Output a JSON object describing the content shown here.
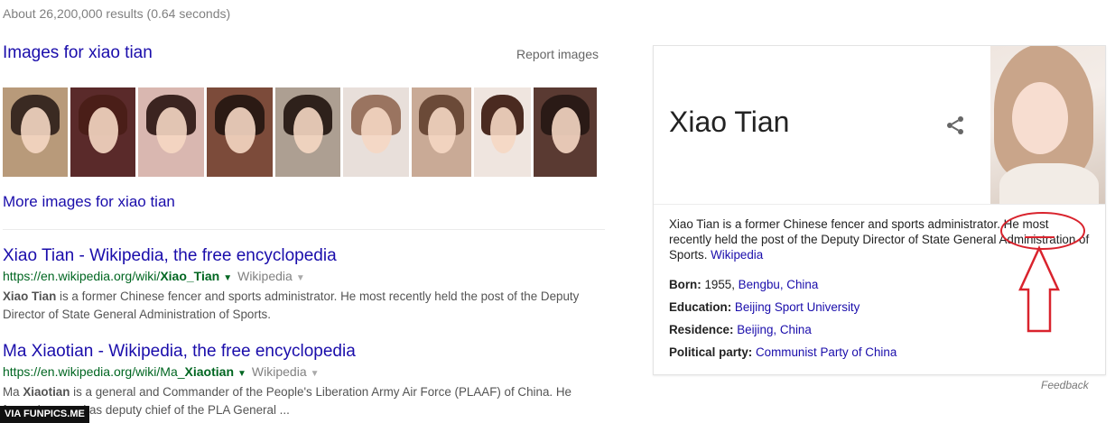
{
  "stats": "About 26,200,000 results (0.64 seconds)",
  "images_block": {
    "title": "Images for xiao tian",
    "report": "Report images",
    "more": "More images for xiao tian",
    "thumbs": [
      {
        "bg": "#b89a7a",
        "hair": "#3a2a22"
      },
      {
        "bg": "#5a2a2a",
        "hair": "#4a1e18"
      },
      {
        "bg": "#d9b7b0",
        "hair": "#3b2420"
      },
      {
        "bg": "#7c4b3a",
        "hair": "#2b1a14"
      },
      {
        "bg": "#ad9f92",
        "hair": "#2e211b"
      },
      {
        "bg": "#e8dfda",
        "hair": "#9a7460"
      },
      {
        "bg": "#c9aa96",
        "hair": "#6b4a38"
      },
      {
        "bg": "#efe5df",
        "hair": "#4a2a20"
      },
      {
        "bg": "#5a3a32",
        "hair": "#2a1a16"
      }
    ]
  },
  "results": [
    {
      "title": "Xiao Tian - Wikipedia, the free encyclopedia",
      "url_prefix": "https://en.wikipedia.org/wiki/",
      "url_bold": "Xiao_Tian",
      "source": "Wikipedia",
      "snippet_bold": "Xiao Tian",
      "snippet": " is a former Chinese fencer and sports administrator. He most recently held the post of the Deputy Director of State General Administration of Sports."
    },
    {
      "title": "Ma Xiaotian - Wikipedia, the free encyclopedia",
      "url_prefix": "https://en.wikipedia.org/wiki/Ma_",
      "url_bold": "Xiaotian",
      "source": "Wikipedia",
      "snippet_pre": "Ma ",
      "snippet_bold": "Xiaotian",
      "snippet": " is a general and Commander of the People's Liberation Army Air Force (PLAAF) of China. He formerly served as deputy chief of the PLA General ..."
    }
  ],
  "knowledge_panel": {
    "title": "Xiao Tian",
    "description": "Xiao Tian is a former Chinese fencer and sports administrator. He most recently held the post of the Deputy Director of State General Administration of Sports.",
    "source_link": "Wikipedia",
    "facts": [
      {
        "label": "Born:",
        "plain": "1955, ",
        "link": "Bengbu, China"
      },
      {
        "label": "Education:",
        "plain": "",
        "link": "Beijing Sport University"
      },
      {
        "label": "Residence:",
        "plain": "",
        "link": "Beijing, China"
      },
      {
        "label": "Political party:",
        "plain": "",
        "link": "Communist Party of China"
      }
    ]
  },
  "feedback": "Feedback",
  "watermark": "VIA FUNPICS.ME",
  "colors": {
    "link": "#1a0dab",
    "url": "#006621",
    "annotation": "#d9232d"
  }
}
